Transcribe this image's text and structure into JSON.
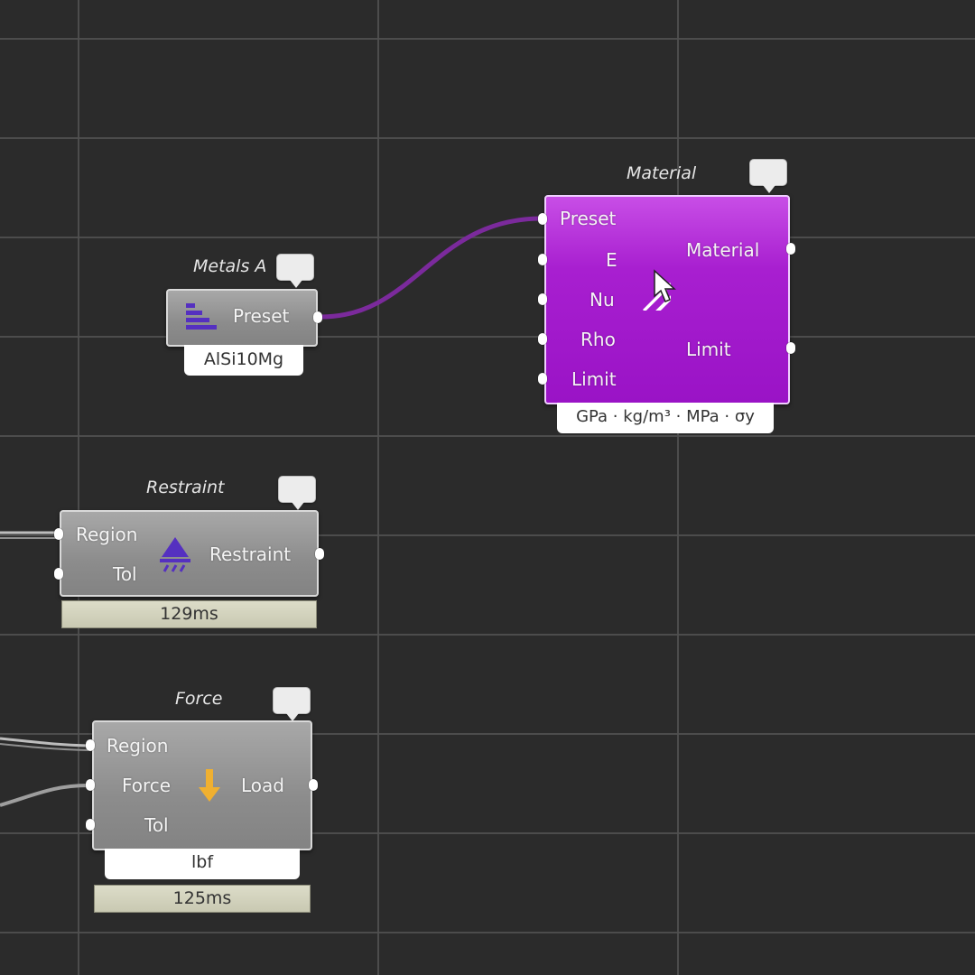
{
  "nodes": {
    "metals": {
      "title": "Metals A",
      "output": "Preset",
      "value": "AlSi10Mg",
      "icon": "stacked-bars-icon"
    },
    "material": {
      "title": "Material",
      "inputs": [
        "Preset",
        "E",
        "Nu",
        "Rho",
        "Limit"
      ],
      "outputs": [
        "Material",
        "Limit"
      ],
      "units": "GPa · kg/m³ · MPa · σy",
      "icon": "hatched-arrow-icon",
      "color": "#a81fd0"
    },
    "restraint": {
      "title": "Restraint",
      "inputs": [
        "Region",
        "Tol"
      ],
      "output": "Restraint",
      "timer": "129ms",
      "icon": "restraint-triangle-icon"
    },
    "force": {
      "title": "Force",
      "inputs": [
        "Region",
        "Force",
        "Tol"
      ],
      "output": "Load",
      "units": "lbf",
      "timer": "125ms",
      "icon": "down-arrow-icon",
      "icon_color": "#f0b030"
    }
  },
  "colors": {
    "canvas": "#2b2b2b",
    "grid": "#505050",
    "wire_purple": "#8a2fb0",
    "wire_grey": "#bdbdbd"
  }
}
